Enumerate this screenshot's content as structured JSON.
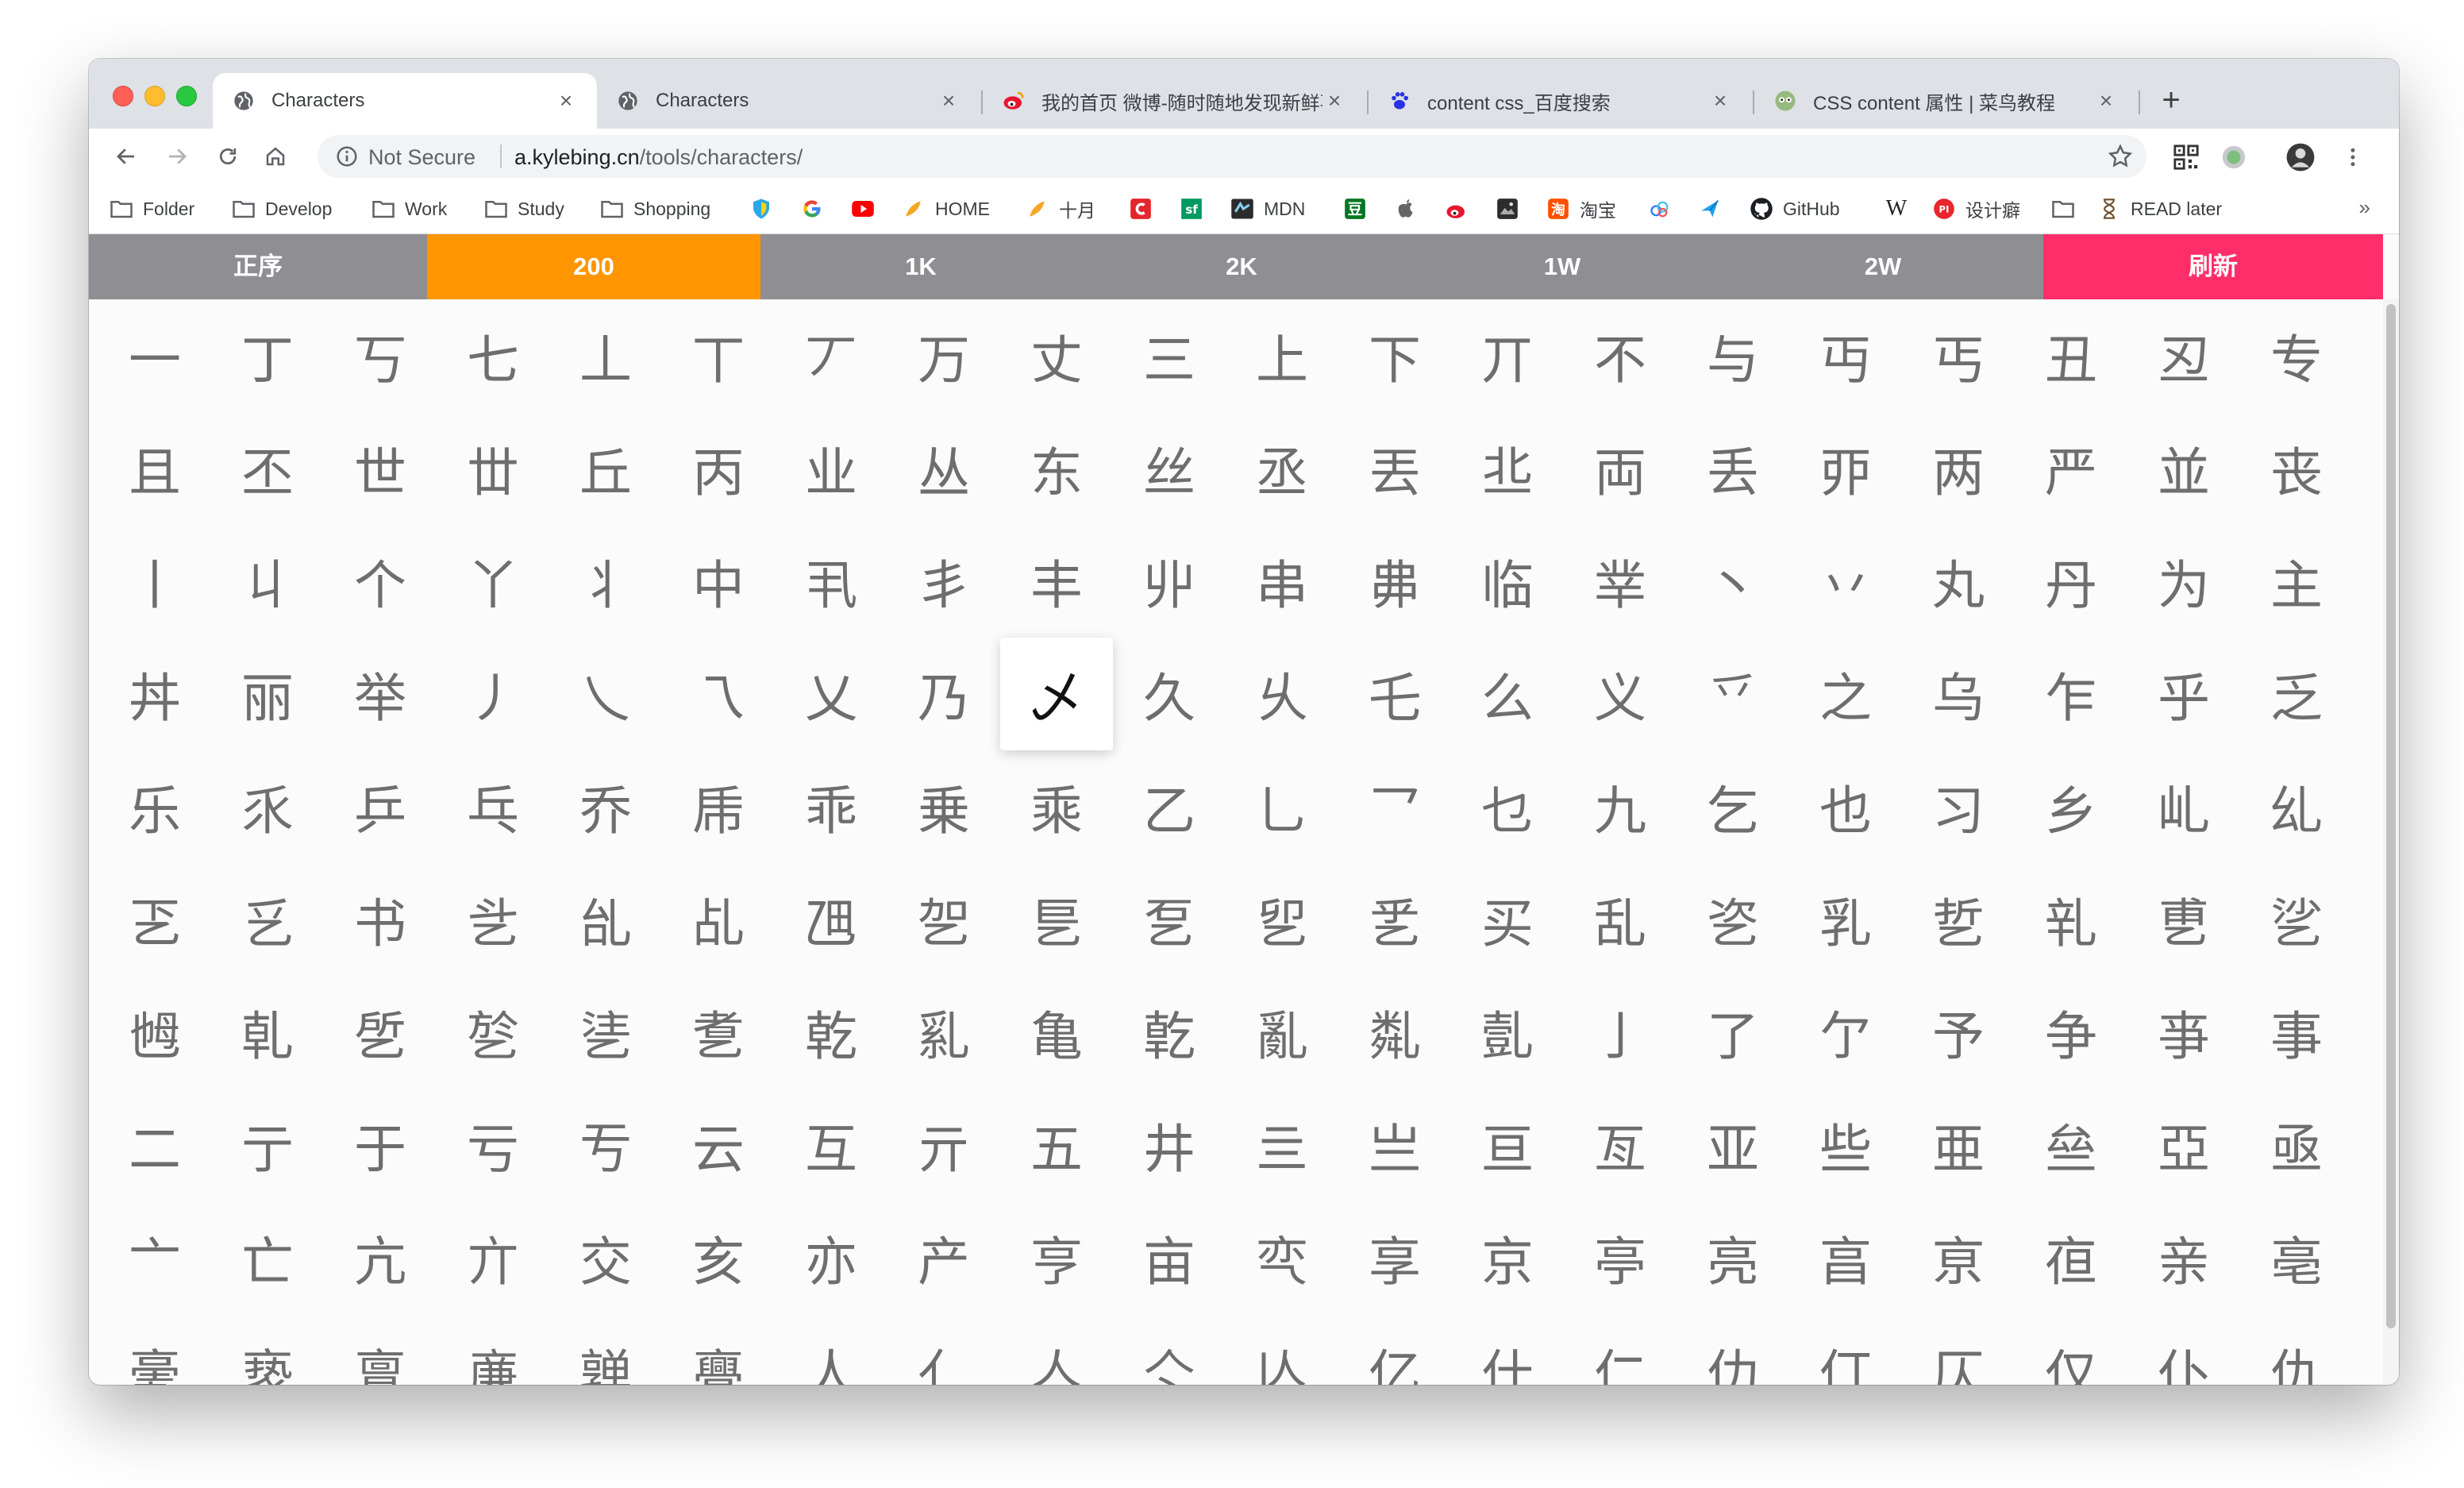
{
  "tabs": [
    {
      "title": "Characters",
      "active": true
    },
    {
      "title": "Characters",
      "active": false
    },
    {
      "title": "我的首页 微博-随时随地发现新鲜事",
      "active": false
    },
    {
      "title": "content css_百度搜索",
      "active": false
    },
    {
      "title": "CSS content 属性 | 菜鸟教程",
      "active": false
    }
  ],
  "toolbar": {
    "security_label": "Not Secure",
    "url_host": "a.kylebing.cn",
    "url_path": "/tools/characters/"
  },
  "bookmarks": [
    {
      "label": "Folder",
      "icon": "folder-icon"
    },
    {
      "label": "Develop",
      "icon": "folder-icon"
    },
    {
      "label": "Work",
      "icon": "folder-icon"
    },
    {
      "label": "Study",
      "icon": "folder-icon"
    },
    {
      "label": "Shopping",
      "icon": "folder-icon"
    },
    {
      "label": "",
      "icon": "shield-icon"
    },
    {
      "label": "",
      "icon": "google-icon"
    },
    {
      "label": "",
      "icon": "youtube-icon"
    },
    {
      "label": "HOME",
      "icon": "feather-icon"
    },
    {
      "label": "十月",
      "icon": "feather-icon"
    },
    {
      "label": "",
      "icon": "c-icon"
    },
    {
      "label": "",
      "icon": "sf-icon"
    },
    {
      "label": "MDN",
      "icon": "mdn-icon"
    },
    {
      "label": "",
      "icon": "douban-icon"
    },
    {
      "label": "",
      "icon": "apple-icon"
    },
    {
      "label": "",
      "icon": "weibo-icon"
    },
    {
      "label": "",
      "icon": "image-icon"
    },
    {
      "label": "淘宝",
      "icon": "taobao-icon"
    },
    {
      "label": "",
      "icon": "cloud-icon"
    },
    {
      "label": "",
      "icon": "bird-icon"
    },
    {
      "label": "GitHub",
      "icon": "github-icon"
    },
    {
      "label": "",
      "icon": "wikipedia-icon"
    },
    {
      "label": "设计癖",
      "icon": "pi-icon"
    },
    {
      "label": "",
      "icon": "folder-icon"
    },
    {
      "label": "READ later",
      "icon": "hourglass-icon"
    }
  ],
  "bookmarks_more": "»",
  "menu": [
    {
      "label": "正序"
    },
    {
      "label": "200"
    },
    {
      "label": "1K"
    },
    {
      "label": "2K"
    },
    {
      "label": "1W"
    },
    {
      "label": "2W"
    },
    {
      "label": "刷新"
    }
  ],
  "colors": {
    "menu_bg": "#8e8e93",
    "menu_active": "#ff9500",
    "menu_refresh": "#ff2d6a",
    "char_color": "#6e6e6e"
  },
  "characters": [
    [
      "一",
      "丁",
      "丂",
      "七",
      "丄",
      "丅",
      "丆",
      "万",
      "丈",
      "三",
      "上",
      "下",
      "丌",
      "不",
      "与",
      "丏",
      "丐",
      "丑",
      "丒",
      "专"
    ],
    [
      "且",
      "丕",
      "世",
      "丗",
      "丘",
      "丙",
      "业",
      "丛",
      "东",
      "丝",
      "丞",
      "丟",
      "丠",
      "両",
      "丢",
      "丣",
      "两",
      "严",
      "並",
      "丧"
    ],
    [
      "丨",
      "丩",
      "个",
      "丫",
      "丬",
      "中",
      "丮",
      "丯",
      "丰",
      "丱",
      "串",
      "丳",
      "临",
      "丵",
      "丶",
      "丷",
      "丸",
      "丹",
      "为",
      "主"
    ],
    [
      "丼",
      "丽",
      "举",
      "丿",
      "乀",
      "乁",
      "乂",
      "乃",
      "乄",
      "久",
      "乆",
      "乇",
      "么",
      "义",
      "乊",
      "之",
      "乌",
      "乍",
      "乎",
      "乏"
    ],
    [
      "乐",
      "乑",
      "乒",
      "乓",
      "乔",
      "乕",
      "乖",
      "乗",
      "乘",
      "乙",
      "乚",
      "乛",
      "乜",
      "九",
      "乞",
      "也",
      "习",
      "乡",
      "乢",
      "乣"
    ],
    [
      "乤",
      "乥",
      "书",
      "乧",
      "乨",
      "乩",
      "乪",
      "乫",
      "乬",
      "乭",
      "乮",
      "乯",
      "买",
      "乱",
      "乲",
      "乳",
      "乴",
      "乵",
      "乶",
      "乷"
    ],
    [
      "乸",
      "乹",
      "乺",
      "乻",
      "乼",
      "乽",
      "乾",
      "乿",
      "亀",
      "亁",
      "亂",
      "亃",
      "亄",
      "亅",
      "了",
      "亇",
      "予",
      "争",
      "亊",
      "事"
    ],
    [
      "二",
      "亍",
      "于",
      "亏",
      "亐",
      "云",
      "互",
      "亓",
      "五",
      "井",
      "亖",
      "亗",
      "亘",
      "亙",
      "亚",
      "些",
      "亜",
      "亝",
      "亞",
      "亟"
    ],
    [
      "亠",
      "亡",
      "亢",
      "亣",
      "交",
      "亥",
      "亦",
      "产",
      "亨",
      "亩",
      "亪",
      "享",
      "京",
      "亭",
      "亮",
      "亯",
      "亰",
      "亱",
      "亲",
      "亳"
    ],
    [
      "亴",
      "亵",
      "亶",
      "亷",
      "亸",
      "亹",
      "人",
      "亻",
      "亼",
      "亽",
      "亾",
      "亿",
      "什",
      "仁",
      "仂",
      "仃",
      "仄",
      "仅",
      "仆",
      "仇"
    ]
  ],
  "highlighted": {
    "row": 3,
    "col": 8
  }
}
